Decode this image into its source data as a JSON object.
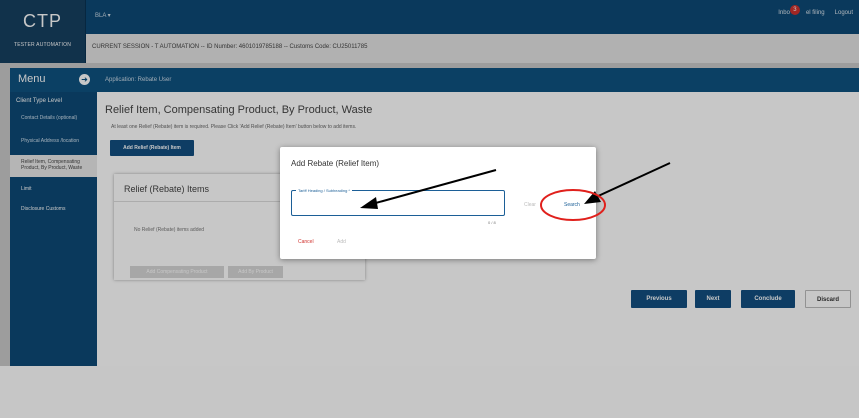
{
  "app": {
    "logo": "CTP",
    "logo_sub": "TESTER AUTOMATION",
    "user_menu": "BLA ▾",
    "inbox_label": "Inbo",
    "inbox_count": "3",
    "lodge_label": "el filing",
    "logout_label": "Logout"
  },
  "session": {
    "text": "CURRENT SESSION - T AUTOMATION -- ID Number: 4601019785188 -- Customs Code: CU25011785"
  },
  "menu": {
    "title": "Menu",
    "level": "Client Type Level",
    "items": [
      "Contact Details (optional)",
      "Physical Address /location",
      "Relief Item, Compensating Product, By Product, Waste",
      "Limit",
      "Disclosure Customs"
    ]
  },
  "appbar": {
    "label": "Application: Rebate User"
  },
  "main": {
    "title": "Relief Item, Compensating Product, By Product, Waste",
    "subtitle": "At least one Relief (Rebate) item is required. Please Click 'Add Relief (Rebate) Item' button below to add items.",
    "add_button": "Add Relief (Rebate) Item",
    "card_title": "Relief (Rebate) Items",
    "no_items": "No Relief (Rebate) items added",
    "add_compensating": "Add Compensating Product",
    "add_byproduct": "Add By Product",
    "previous": "Previous",
    "next": "Next",
    "conclude": "Conclude",
    "discard": "Discard"
  },
  "dialog": {
    "title": "Add Rebate (Relief Item)",
    "field_label": "Tariff Heading / Subheading *",
    "field_value": "",
    "counter": "0 / 8",
    "clear": "Clear",
    "search": "Search",
    "cancel": "Cancel",
    "add": "Add"
  },
  "colors": {
    "primary": "#0e4a76",
    "button": "#124f80",
    "annotation_circle": "#e0201c",
    "cancel": "#d0312d"
  }
}
